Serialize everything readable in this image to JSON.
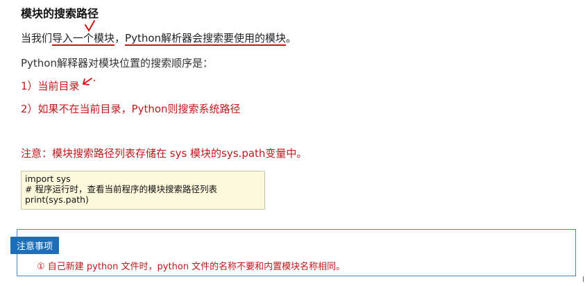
{
  "title": "模块的搜索路径",
  "line1": {
    "prefix": "当我们",
    "underlined1": "导入一个模块",
    "mid": "，",
    "underlined2": "Python解析器会搜索要使用的模块",
    "suffix": "。"
  },
  "line2": "Python解释器对模块位置的搜索顺序是：",
  "item1": "1）当前目录",
  "item2": "2）如果不在当前目录，Python则搜索系统路径",
  "note": "注意：模块搜索路径列表存储在 sys 模块的sys.path变量中。",
  "code": [
    "import sys",
    "# 程序运行时，查看当前程序的模块搜索路径列表",
    "print(sys.path)"
  ],
  "tip": {
    "badge": "注意事项",
    "text": "① 自己新建 python 文件时，python 文件的名称不要和内置模块名称相同。"
  },
  "colors": {
    "red": "#c0181c",
    "badge_blue": "#1f6fb8",
    "code_bg": "#fcf9dc"
  }
}
